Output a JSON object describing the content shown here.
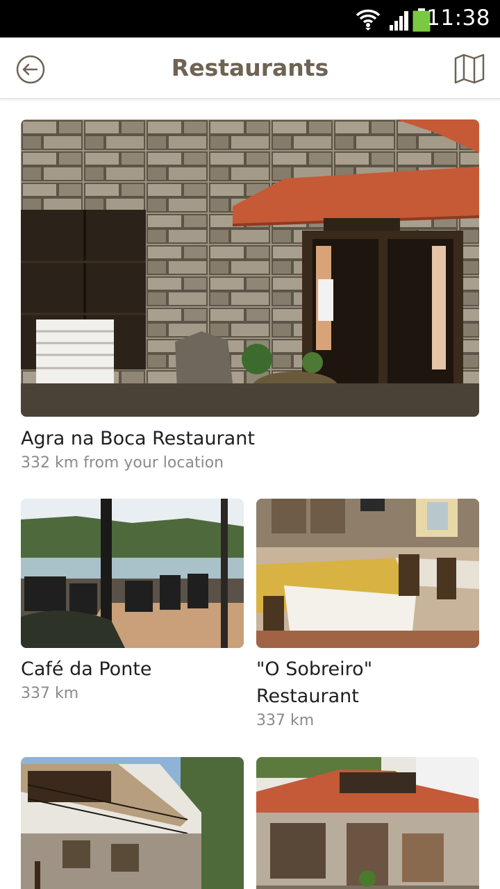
{
  "status_bar": {
    "time": "11:38",
    "wifi_icon": "wifi-icon",
    "signal_icon": "signal-icon",
    "battery_icon": "battery-icon",
    "battery_color": "#7ac943"
  },
  "app_bar": {
    "title": "Restaurants",
    "back_icon": "back-arrow-icon",
    "map_icon": "map-icon"
  },
  "restaurants": [
    {
      "name": "Agra na Boca Restaurant",
      "distance": "332 km from your location"
    },
    {
      "name": "Café da Ponte",
      "distance": "337 km"
    },
    {
      "name": "\"O Sobreiro\"",
      "name_line2": "Restaurant",
      "distance": "337 km"
    },
    {
      "name": "",
      "distance": ""
    },
    {
      "name": "",
      "distance": ""
    }
  ],
  "colors": {
    "title": "#6e6354",
    "status_bar": "#000000",
    "distance": "#8a8a8a"
  }
}
